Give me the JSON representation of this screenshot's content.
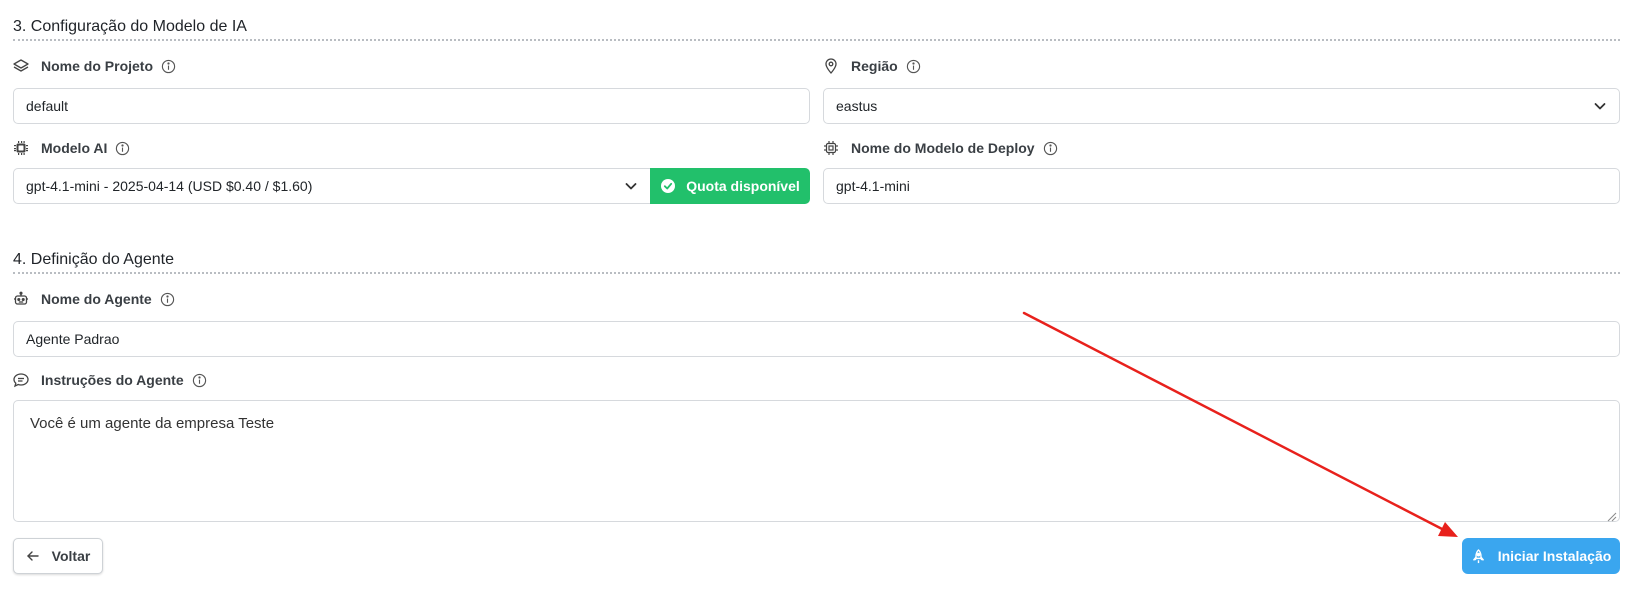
{
  "section3": {
    "title": "3. Configuração do Modelo de IA",
    "project_name": {
      "label": "Nome do Projeto",
      "value": "default",
      "icon": "layers-icon"
    },
    "region": {
      "label": "Região",
      "value": "eastus",
      "icon": "map-pin-icon"
    },
    "ai_model": {
      "label": "Modelo AI",
      "value": "gpt-4.1-mini - 2025-04-14 (USD $0.40 / $1.60)",
      "icon": "chip-icon"
    },
    "quota": {
      "label": "Quota disponível",
      "color": "#22c06b",
      "icon": "check-circle-icon"
    },
    "deploy_model_name": {
      "label": "Nome do Modelo de Deploy",
      "value": "gpt-4.1-mini",
      "icon": "chip-outline-icon"
    }
  },
  "section4": {
    "title": "4. Definição do Agente",
    "agent_name": {
      "label": "Nome do Agente",
      "value": "Agente Padrao",
      "icon": "robot-icon"
    },
    "agent_instructions": {
      "label": "Instruções do Agente",
      "value": "Você é um agente da empresa Teste",
      "icon": "chat-icon"
    }
  },
  "actions": {
    "back_label": "Voltar",
    "install_label": "Iniciar Instalação",
    "install_color": "#3aa6ef"
  },
  "annotation": {
    "arrow_color": "#e8211c"
  }
}
